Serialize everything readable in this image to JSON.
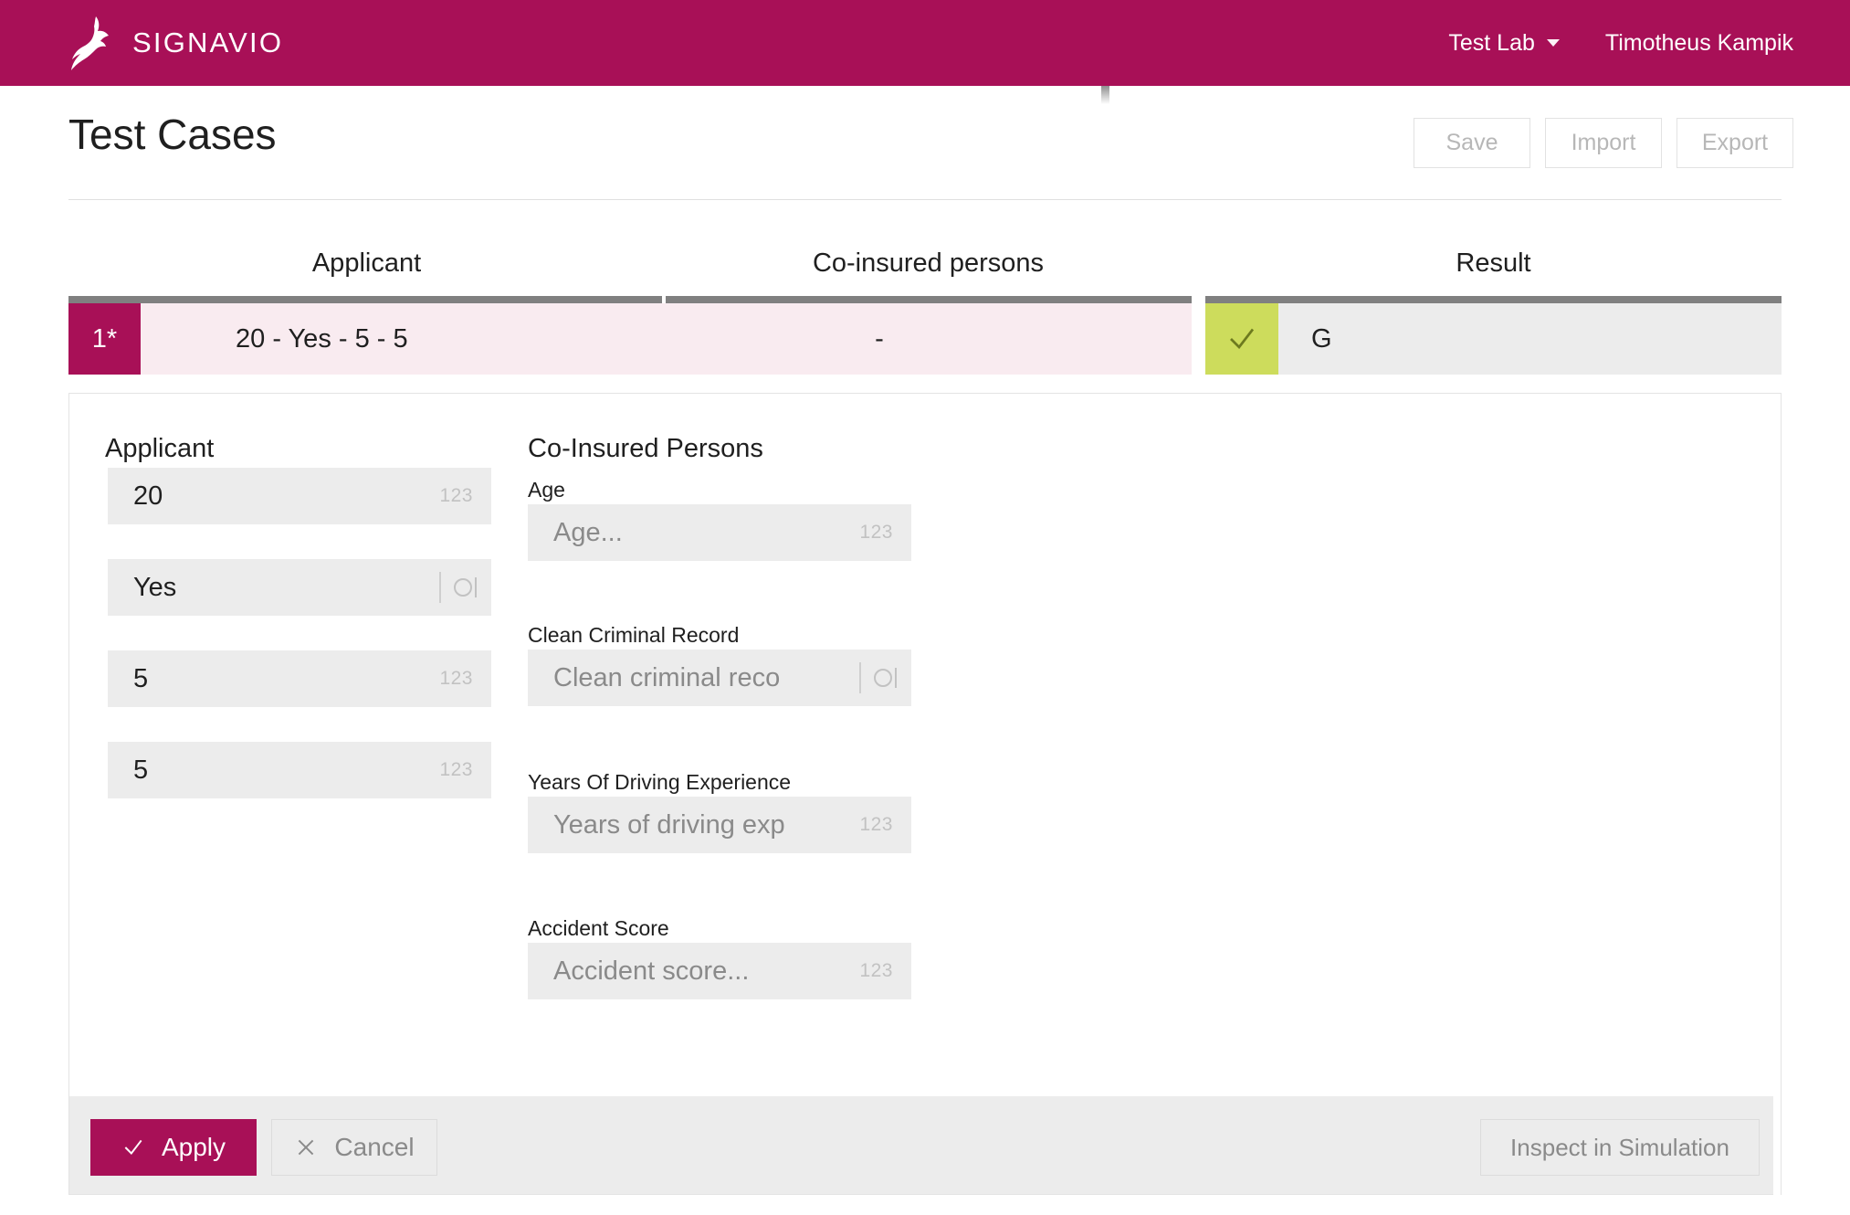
{
  "brand": {
    "name": "SIGNAVIO",
    "logo_icon": "gazelle-logo-icon"
  },
  "topnav": {
    "workspace": "Test Lab",
    "workspace_caret_icon": "chevron-down-icon",
    "user": "Timotheus Kampik"
  },
  "page": {
    "title": "Test Cases",
    "actions": [
      {
        "label": "Save"
      },
      {
        "label": "Import"
      },
      {
        "label": "Export"
      }
    ]
  },
  "table": {
    "columns": [
      {
        "label": "Applicant"
      },
      {
        "label": "Co-insured persons"
      },
      {
        "label": "Result"
      }
    ],
    "rows": [
      {
        "index": "1*",
        "applicant": "20 - Yes - 5 - 5",
        "coinsured": "-",
        "result_icon": "check-icon",
        "result": "G"
      }
    ]
  },
  "detail": {
    "applicant_group": {
      "title": "Applicant",
      "fields": [
        {
          "value": "20",
          "hint": "123",
          "type": "number"
        },
        {
          "value": "Yes",
          "hint": "",
          "type": "boolean"
        },
        {
          "value": "5",
          "hint": "123",
          "type": "number"
        },
        {
          "value": "5",
          "hint": "123",
          "type": "number"
        }
      ]
    },
    "coinsured_group": {
      "title": "Co-Insured Persons",
      "fields": [
        {
          "label": "Age",
          "placeholder": "Age...",
          "hint": "123",
          "type": "number"
        },
        {
          "label": "Clean Criminal Record",
          "placeholder": "Clean criminal reco",
          "hint": "",
          "type": "boolean"
        },
        {
          "label": "Years Of Driving Experience",
          "placeholder": "Years of driving exp",
          "hint": "123",
          "type": "number"
        },
        {
          "label": "Accident Score",
          "placeholder": "Accident score...",
          "hint": "123",
          "type": "number"
        }
      ]
    }
  },
  "footer": {
    "apply_label": "Apply",
    "apply_icon": "check-icon",
    "cancel_label": "Cancel",
    "cancel_icon": "close-icon",
    "inspect_label": "Inspect in Simulation"
  },
  "colors": {
    "brand": "#A81057",
    "row_highlight": "#f9ebf0",
    "result_ok": "#CDDC5C",
    "field_bg": "#ececec"
  }
}
